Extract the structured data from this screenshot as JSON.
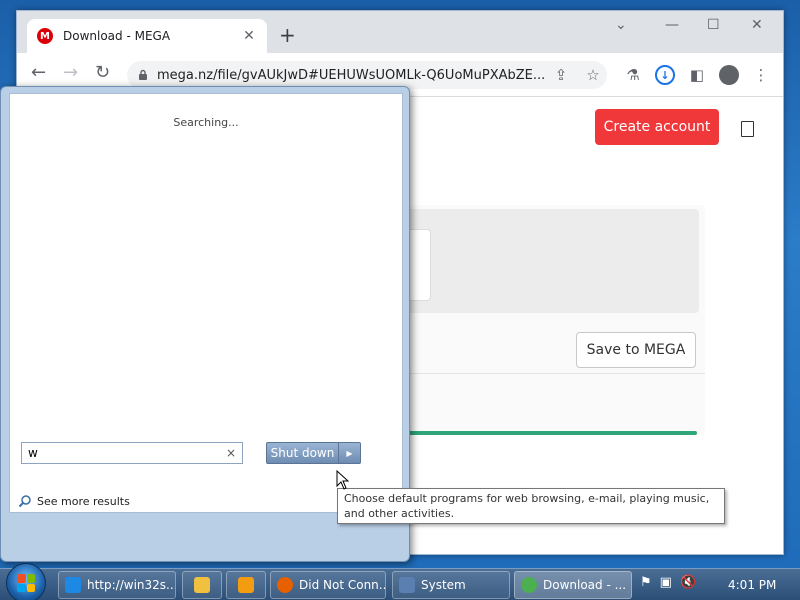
{
  "browser": {
    "tab_title": "Download - MEGA",
    "tab_favicon": "M",
    "new_tab": "+",
    "url": "mega.nz/file/gvAUkJwD#UEHUWsUOMLk-Q6UoMuPXAbZE...",
    "create_account": "Create account",
    "save_to_mega": "Save to MEGA",
    "download_progress": 1.0,
    "colors": {
      "brand": "#d90007",
      "create_account": "#f0373a",
      "progress": "#2fa678"
    }
  },
  "start_menu": {
    "status": "Searching...",
    "see_more": "See more results",
    "search_value": "w",
    "clear": "×",
    "shutdown_label": "Shut down",
    "shutdown_arrow": "▶"
  },
  "tooltip": {
    "text": "Choose default programs for web browsing, e-mail, playing music, and other activities."
  },
  "taskbar": {
    "items": [
      {
        "label": "http://win32s...",
        "icon": "ie-icon"
      },
      {
        "label": "",
        "icon": "folder-icon"
      },
      {
        "label": "",
        "icon": "media-icon"
      },
      {
        "label": "Did Not Conn...",
        "icon": "firefox-icon"
      },
      {
        "label": "System",
        "icon": "system-icon"
      },
      {
        "label": "Download - ...",
        "icon": "chrome-icon"
      }
    ],
    "clock": "4:01 PM"
  }
}
